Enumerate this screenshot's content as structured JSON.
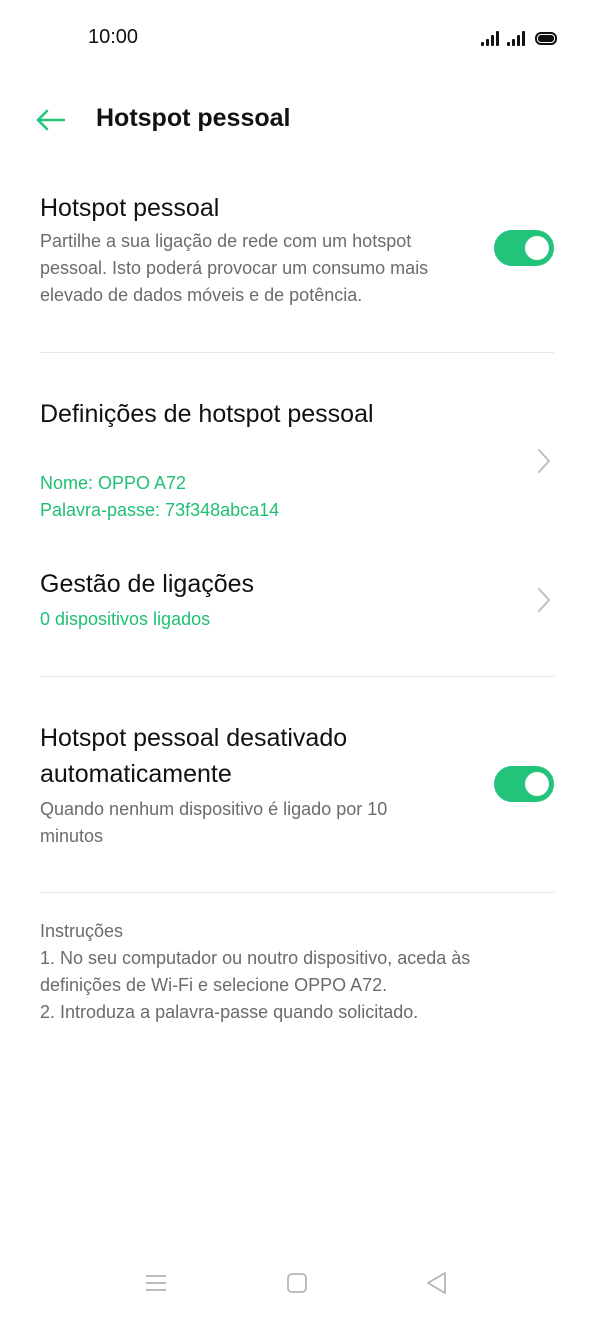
{
  "status_bar": {
    "time": "10:00"
  },
  "header": {
    "title": "Hotspot pessoal",
    "back_icon": "arrow-left-icon"
  },
  "hotspot": {
    "title": "Hotspot pessoal",
    "description": "Partilhe a sua ligação de rede com um hotspot pessoal. Isto poderá provocar um consumo mais elevado de dados móveis e de potência.",
    "enabled": true
  },
  "settings": {
    "title": "Definições de hotspot pessoal",
    "name_line": "Nome: OPPO A72",
    "password_line": "Palavra-passe: 73f348abca14"
  },
  "connections": {
    "title": "Gestão de ligações",
    "subtitle": "0 dispositivos ligados"
  },
  "auto_off": {
    "title_line1": "Hotspot pessoal desativado",
    "title_line2": "automaticamente",
    "description": "Quando nenhum dispositivo é ligado por 10 minutos",
    "enabled": true
  },
  "instructions": {
    "heading": "Instruções",
    "lines": [
      "1. No seu computador ou noutro dispositivo, aceda às definições de Wi-Fi e selecione OPPO A72.",
      "2. Introduza a palavra-passe quando solicitado."
    ]
  },
  "nav_bar": {
    "icons": [
      "menu-icon",
      "home-icon",
      "back-triangle-icon"
    ]
  },
  "colors": {
    "accent": "#23c37a",
    "accent_text": "#1fbf73",
    "secondary_text": "#6b6b6b",
    "divider": "#e6e6e6"
  }
}
